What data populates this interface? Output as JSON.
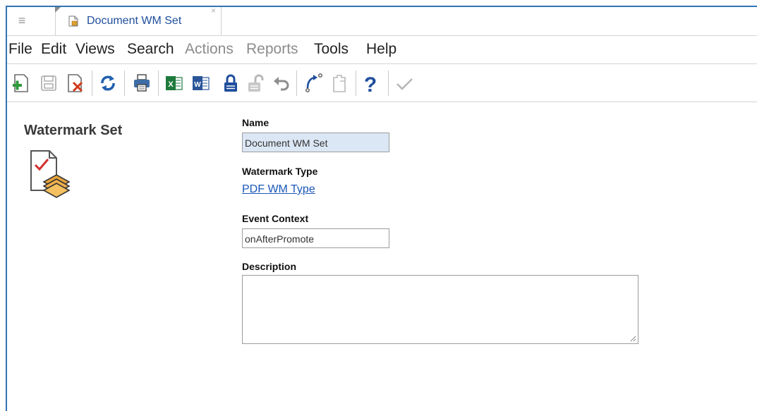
{
  "tab": {
    "label": "Document WM Set",
    "close_glyph": "×"
  },
  "menu": [
    {
      "label": "File",
      "enabled": true
    },
    {
      "label": "Edit",
      "enabled": true
    },
    {
      "label": "Views",
      "enabled": true
    },
    {
      "label": "Search",
      "enabled": true
    },
    {
      "label": "Actions",
      "enabled": false
    },
    {
      "label": "Reports",
      "enabled": false
    },
    {
      "label": "Tools",
      "enabled": true
    },
    {
      "label": "Help",
      "enabled": true
    }
  ],
  "toolbar": [
    {
      "name": "new-item-icon",
      "enabled": true
    },
    {
      "name": "save-icon",
      "enabled": false
    },
    {
      "name": "delete-icon",
      "enabled": true
    },
    {
      "name": "refresh-icon",
      "enabled": true
    },
    {
      "name": "print-icon",
      "enabled": true
    },
    {
      "name": "export-excel-icon",
      "enabled": true
    },
    {
      "name": "export-word-icon",
      "enabled": true
    },
    {
      "name": "lock-icon",
      "enabled": true
    },
    {
      "name": "unlock-icon",
      "enabled": false
    },
    {
      "name": "undo-icon",
      "enabled": false
    },
    {
      "name": "promote-icon",
      "enabled": true
    },
    {
      "name": "clipboard-icon",
      "enabled": false
    },
    {
      "name": "help-icon",
      "enabled": true
    },
    {
      "name": "done-check-icon",
      "enabled": false
    }
  ],
  "form": {
    "title": "Watermark Set",
    "name_label": "Name",
    "name_value": "Document WM Set",
    "type_label": "Watermark Type",
    "type_value": "PDF WM Type",
    "event_label": "Event Context",
    "event_value": "onAfterPromote",
    "description_label": "Description",
    "description_value": ""
  },
  "colors": {
    "accent": "#2e75b6",
    "link": "#1a57b8",
    "name_field_bg": "#dce7f5",
    "disabled": "#8c8c8c"
  }
}
